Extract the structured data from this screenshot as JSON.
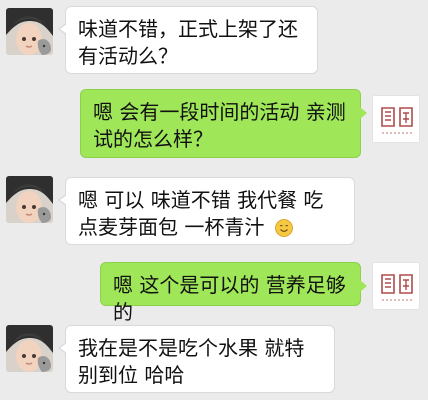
{
  "messages": [
    {
      "side": "left",
      "text": "味道不错，正式上架了还有活动么？"
    },
    {
      "side": "right",
      "text": "嗯 会有一段时间的活动 亲测试的怎么样？"
    },
    {
      "side": "left",
      "text": "嗯 可以 味道不错 我代餐 吃点麦芽面包 一杯青汁",
      "emoji": "smiling-face-emoji"
    },
    {
      "side": "right",
      "text": "嗯 这个是可以的 营养足够的"
    },
    {
      "side": "left",
      "text": "我在是不是吃个水果 就特别到位 哈哈"
    }
  ],
  "colors": {
    "chat_background": "#ebebeb",
    "incoming_bubble": "#ffffff",
    "outgoing_bubble": "#9fe658"
  }
}
